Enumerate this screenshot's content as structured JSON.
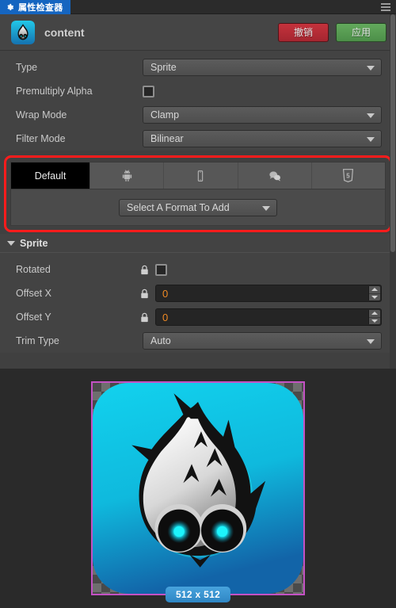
{
  "window": {
    "panel_tab_label": "属性检查器",
    "panel_tab_icon": "gear-icon",
    "menu_icon": "hamburger-menu-icon",
    "accent_color": "#1565c0"
  },
  "header": {
    "asset_icon": "cocos-creator-logo-icon",
    "asset_name": "content",
    "revert_label": "撤销",
    "apply_label": "应用",
    "revert_color": "#c4323c",
    "apply_color": "#63a95c"
  },
  "properties": [
    {
      "label": "Type",
      "control": "select",
      "value": "Sprite"
    },
    {
      "label": "Premultiply Alpha",
      "control": "checkbox",
      "checked": false
    },
    {
      "label": "Wrap Mode",
      "control": "select",
      "value": "Clamp"
    },
    {
      "label": "Filter Mode",
      "control": "select",
      "value": "Bilinear"
    }
  ],
  "format_block": {
    "highlight_color": "#ff1c1c",
    "tabs": [
      {
        "label": "Default",
        "icon": null,
        "active": true
      },
      {
        "label": "",
        "icon": "android-icon",
        "active": false
      },
      {
        "label": "",
        "icon": "mobile-device-icon",
        "active": false
      },
      {
        "label": "",
        "icon": "wechat-chat-icon",
        "active": false
      },
      {
        "label": "",
        "icon": "html5-icon",
        "active": false
      }
    ],
    "add_format_value": "Select A Format To Add"
  },
  "sprite_section": {
    "title": "Sprite",
    "expanded": true,
    "rows": [
      {
        "label": "Rotated",
        "control": "checkbox",
        "checked": false,
        "locked": true
      },
      {
        "label": "Offset X",
        "control": "number",
        "value": "0",
        "locked": true
      },
      {
        "label": "Offset Y",
        "control": "number",
        "value": "0",
        "locked": true
      },
      {
        "label": "Trim Type",
        "control": "select",
        "value": "Auto",
        "locked": false
      }
    ],
    "number_color": "#f08a24"
  },
  "preview": {
    "size_label": "512 x 512",
    "border_color": "#c451c4",
    "badge_color": "#2f86c4",
    "image_name": "cocos-creator-logo-image"
  }
}
